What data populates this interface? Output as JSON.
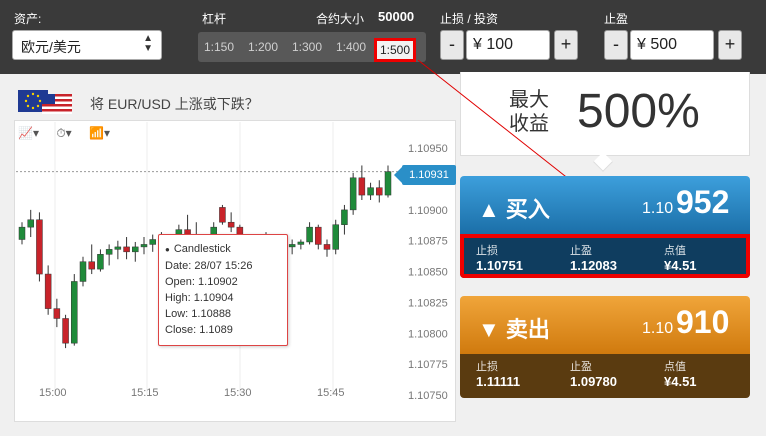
{
  "asset": {
    "label": "资产:",
    "value": "欧元/美元"
  },
  "leverage": {
    "label": "杠杆",
    "contract_label": "合约大小",
    "contract_value": "50000",
    "options": [
      "1:150",
      "1:200",
      "1:300",
      "1:400",
      "1:500"
    ],
    "active": "1:500"
  },
  "stop_loss": {
    "label": "止损 / 投资",
    "minus": "-",
    "plus": "+",
    "value": "¥ 100"
  },
  "take_profit": {
    "label": "止盈",
    "minus": "-",
    "plus": "+",
    "value": "¥ 500"
  },
  "max_profit": {
    "label": "最大收益",
    "value": "500%"
  },
  "question": "将 EUR/USD 上涨或下跌？",
  "chart_tools": [
    "📈▾",
    "⏱▾",
    "📶▾"
  ],
  "current_price": "1.10931",
  "chart_data": {
    "type": "candlestick",
    "ylim": [
      1.1075,
      1.10955
    ],
    "y_ticks": [
      "1.10950",
      "1.10925",
      "1.10900",
      "1.10875",
      "1.10850",
      "1.10825",
      "1.10800",
      "1.10775",
      "1.10750"
    ],
    "x_ticks": [
      "15:00",
      "15:15",
      "15:30",
      "15:45"
    ],
    "candles": [
      [
        1.10876,
        1.1089,
        1.10872,
        1.10886
      ],
      [
        1.10886,
        1.109,
        1.10878,
        1.10892
      ],
      [
        1.10892,
        1.10898,
        1.10842,
        1.10848
      ],
      [
        1.10848,
        1.10855,
        1.10815,
        1.1082
      ],
      [
        1.1082,
        1.10828,
        1.10805,
        1.10812
      ],
      [
        1.10812,
        1.10815,
        1.10788,
        1.10792
      ],
      [
        1.10792,
        1.10848,
        1.1079,
        1.10842
      ],
      [
        1.10842,
        1.10862,
        1.10838,
        1.10858
      ],
      [
        1.10858,
        1.10872,
        1.10848,
        1.10852
      ],
      [
        1.10852,
        1.10868,
        1.1085,
        1.10864
      ],
      [
        1.10864,
        1.10872,
        1.10855,
        1.10868
      ],
      [
        1.10868,
        1.10875,
        1.1086,
        1.1087
      ],
      [
        1.1087,
        1.10878,
        1.1086,
        1.10866
      ],
      [
        1.10866,
        1.10874,
        1.10858,
        1.1087
      ],
      [
        1.1087,
        1.10878,
        1.10864,
        1.10872
      ],
      [
        1.10872,
        1.1088,
        1.10866,
        1.10876
      ],
      [
        1.10876,
        1.10882,
        1.10868,
        1.10874
      ],
      [
        1.10874,
        1.10876,
        1.1086,
        1.10866
      ],
      [
        1.10866,
        1.10888,
        1.10864,
        1.10884
      ],
      [
        1.10884,
        1.10896,
        1.10876,
        1.1088
      ],
      [
        1.1088,
        1.1089,
        1.10868,
        1.10872
      ],
      [
        1.10872,
        1.10878,
        1.10862,
        1.10866
      ],
      [
        1.10866,
        1.1089,
        1.10864,
        1.10886
      ],
      [
        1.10902,
        1.10904,
        1.10888,
        1.1089
      ],
      [
        1.1089,
        1.10898,
        1.10882,
        1.10886
      ],
      [
        1.10886,
        1.10888,
        1.10872,
        1.10876
      ],
      [
        1.10876,
        1.1088,
        1.10868,
        1.10872
      ],
      [
        1.10872,
        1.10878,
        1.10866,
        1.10874
      ],
      [
        1.10874,
        1.10882,
        1.10868,
        1.10876
      ],
      [
        1.10876,
        1.1088,
        1.1087,
        1.10874
      ],
      [
        1.10874,
        1.10878,
        1.10866,
        1.1087
      ],
      [
        1.1087,
        1.10876,
        1.10864,
        1.10872
      ],
      [
        1.10872,
        1.10876,
        1.10868,
        1.10874
      ],
      [
        1.10874,
        1.1089,
        1.10872,
        1.10886
      ],
      [
        1.10886,
        1.10888,
        1.10868,
        1.10872
      ],
      [
        1.10872,
        1.10876,
        1.10862,
        1.10868
      ],
      [
        1.10868,
        1.10892,
        1.10864,
        1.10888
      ],
      [
        1.10888,
        1.10904,
        1.1088,
        1.109
      ],
      [
        1.109,
        1.1093,
        1.10896,
        1.10926
      ],
      [
        1.10926,
        1.10936,
        1.10908,
        1.10912
      ],
      [
        1.10912,
        1.10922,
        1.10908,
        1.10918
      ],
      [
        1.10918,
        1.10924,
        1.10906,
        1.10912
      ],
      [
        1.10912,
        1.10936,
        1.1091,
        1.10931
      ]
    ],
    "current": 1.10931
  },
  "tooltip": {
    "title": "Candlestick",
    "date": "Date: 28/07 15:26",
    "open": "Open: 1.10902",
    "high": "High: 1.10904",
    "low": "Low: 1.10888",
    "close": "Close: 1.1089"
  },
  "buy": {
    "label": "买入",
    "price_small": "1.10",
    "price_big": "952",
    "sl_label": "止损",
    "sl": "1.10751",
    "tp_label": "止盈",
    "tp": "1.12083",
    "pip_label": "点值",
    "pip": "¥4.51"
  },
  "sell": {
    "label": "卖出",
    "price_small": "1.10",
    "price_big": "910",
    "sl_label": "止损",
    "sl": "1.11111",
    "tp_label": "止盈",
    "tp": "1.09780",
    "pip_label": "点值",
    "pip": "¥4.51"
  },
  "colors": {
    "up": "#1f8a3a",
    "down": "#c8232a",
    "accent": "#2a8fc8",
    "highlight": "#e00000"
  }
}
